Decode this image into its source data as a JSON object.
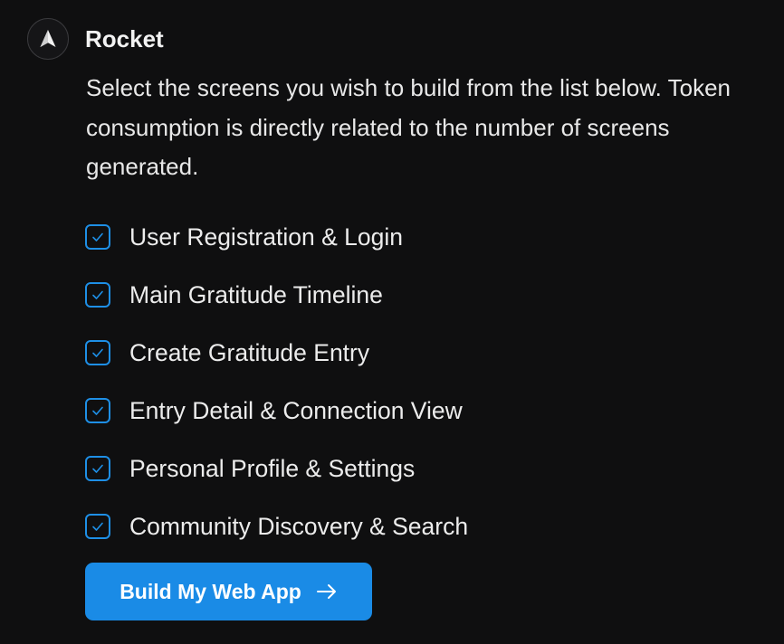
{
  "header": {
    "brand_name": "Rocket",
    "avatar_icon": "rocket-logo-icon"
  },
  "message": {
    "text": "Select the screens you wish to build from the list below. Token consumption is directly related to the number of screens generated."
  },
  "screens": [
    {
      "label": "User Registration & Login",
      "checked": true
    },
    {
      "label": "Main Gratitude Timeline",
      "checked": true
    },
    {
      "label": "Create Gratitude Entry",
      "checked": true
    },
    {
      "label": "Entry Detail & Connection View",
      "checked": true
    },
    {
      "label": "Personal Profile & Settings",
      "checked": true
    },
    {
      "label": "Community Discovery & Search",
      "checked": true
    }
  ],
  "build_button": {
    "label": "Build My Web App",
    "icon": "arrow-right-icon"
  },
  "colors": {
    "background": "#0f0f10",
    "accent": "#1a8be6",
    "checkbox_border": "#1e8fe6",
    "text": "#ececec"
  }
}
